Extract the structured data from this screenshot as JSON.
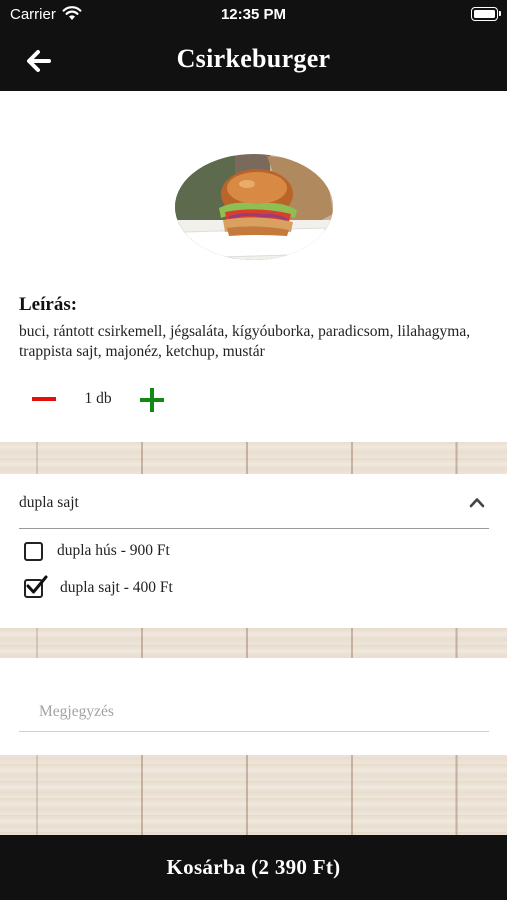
{
  "status_bar": {
    "carrier": "Carrier",
    "time": "12:35 PM"
  },
  "header": {
    "title": "Csirkeburger",
    "back_icon": "arrow-left-icon"
  },
  "product": {
    "image": "burger-photo",
    "description_heading": "Leírás:",
    "description": "buci, rántott csirkemell, jégsaláta, kígyóuborka, paradicsom, lilahagyma, trappista sajt, majonéz, ketchup, mustár",
    "quantity": "1 db"
  },
  "options": {
    "selected_summary": "dupla sajt",
    "expanded": true,
    "items": [
      {
        "label": "dupla hús - 900 Ft",
        "checked": false
      },
      {
        "label": "dupla sajt - 400 Ft",
        "checked": true
      }
    ]
  },
  "note": {
    "placeholder": "Megjegyzés",
    "value": ""
  },
  "cart": {
    "label": "Kosárba (2 390 Ft)"
  },
  "colors": {
    "bar_background": "#111111",
    "minus": "#e41010",
    "plus": "#128a12"
  }
}
